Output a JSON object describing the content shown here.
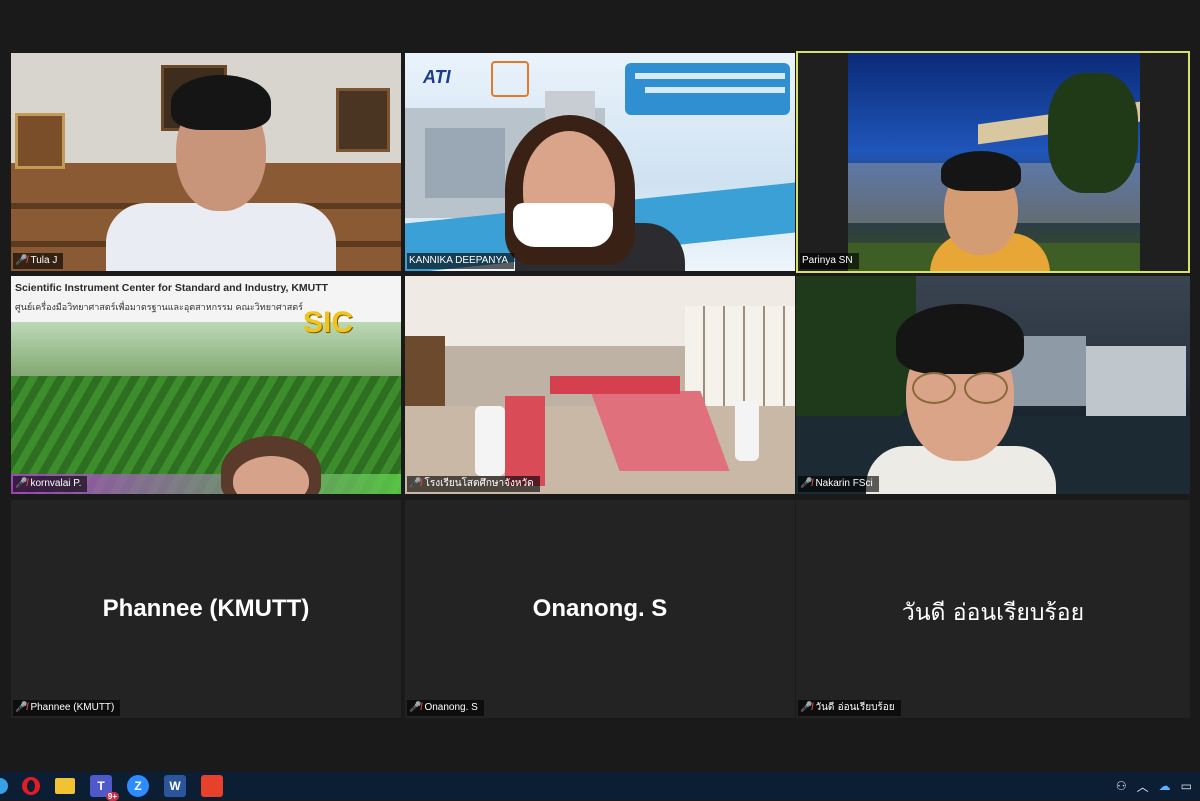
{
  "participants": [
    {
      "name": "Tula J",
      "mic": "muted",
      "video": true
    },
    {
      "name": "KANNIKA DEEPANYA",
      "mic": "unmuted",
      "video": true
    },
    {
      "name": "Parinya SN",
      "mic": "unmuted",
      "video": true,
      "active_speaker": true
    },
    {
      "name": "kornvalai P.",
      "mic": "muted",
      "video": true
    },
    {
      "name": "โรงเรียนโสตศึกษาจังหวัด",
      "mic": "muted",
      "video": true
    },
    {
      "name": "Nakarin FSci",
      "mic": "muted",
      "video": true
    },
    {
      "name": "Phannee (KMUTT)",
      "display": "Phannee (KMUTT)",
      "mic": "muted",
      "video": false
    },
    {
      "name": "Onanong. S",
      "display": "Onanong. S",
      "mic": "muted",
      "video": false
    },
    {
      "name": "วันดี อ่อนเรียบร้อย",
      "display": "วันดี อ่อนเรียบร้อย",
      "mic": "muted",
      "video": false
    }
  ],
  "backgrounds": {
    "sic_title": "Scientific Instrument Center for Standard and Industry, KMUTT",
    "sic_thai": "ศูนย์เครื่องมือวิทยาศาสตร์เพื่อมาตรฐานและอุตสาหกรรม คณะวิทยาศาสตร์",
    "sic_logo": "SIC",
    "ati_logo": "ATI"
  },
  "taskbar": {
    "apps": [
      "windows-icon",
      "opera-icon",
      "file-explorer-icon",
      "teams-icon",
      "zoom-icon",
      "word-icon",
      "acrobat-icon"
    ],
    "teams_badge": "9+",
    "word_letter": "W",
    "zoom_letter": "Z"
  },
  "colors": {
    "active_border": "#d6e26a",
    "muted_icon": "#e0443a",
    "taskbar": "#0b1e33"
  }
}
